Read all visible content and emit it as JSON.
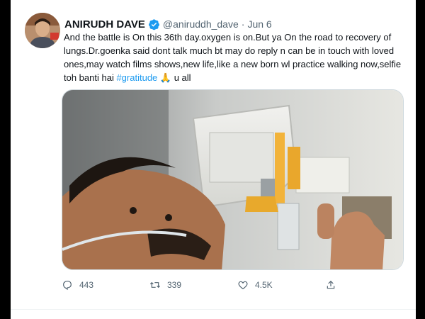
{
  "tweet": {
    "author_name": "ANIRUDH DAVE",
    "handle": "@aniruddh_dave",
    "separator": "·",
    "date": "Jun 6",
    "text_before_hashtag": "And the battle is On this 36th day.oxygen is on.But ya On the road to recovery of lungs.Dr.goenka said dont talk much bt may do reply n can be in touch with loved ones,may watch films shows,new life,like a new born wl practice walking now,selfie toh banti hai ",
    "hashtag": "#gratitude",
    "emoji": "🙏",
    "text_after_emoji": " u all"
  },
  "actions": {
    "reply_count": "443",
    "retweet_count": "339",
    "like_count": "4.5K"
  },
  "icons": {
    "verified": "verified-badge-icon",
    "reply": "reply-icon",
    "retweet": "retweet-icon",
    "like": "heart-icon",
    "share": "share-icon"
  },
  "colors": {
    "accent": "#1d9bf0",
    "text": "#0f1419",
    "muted": "#536471"
  }
}
